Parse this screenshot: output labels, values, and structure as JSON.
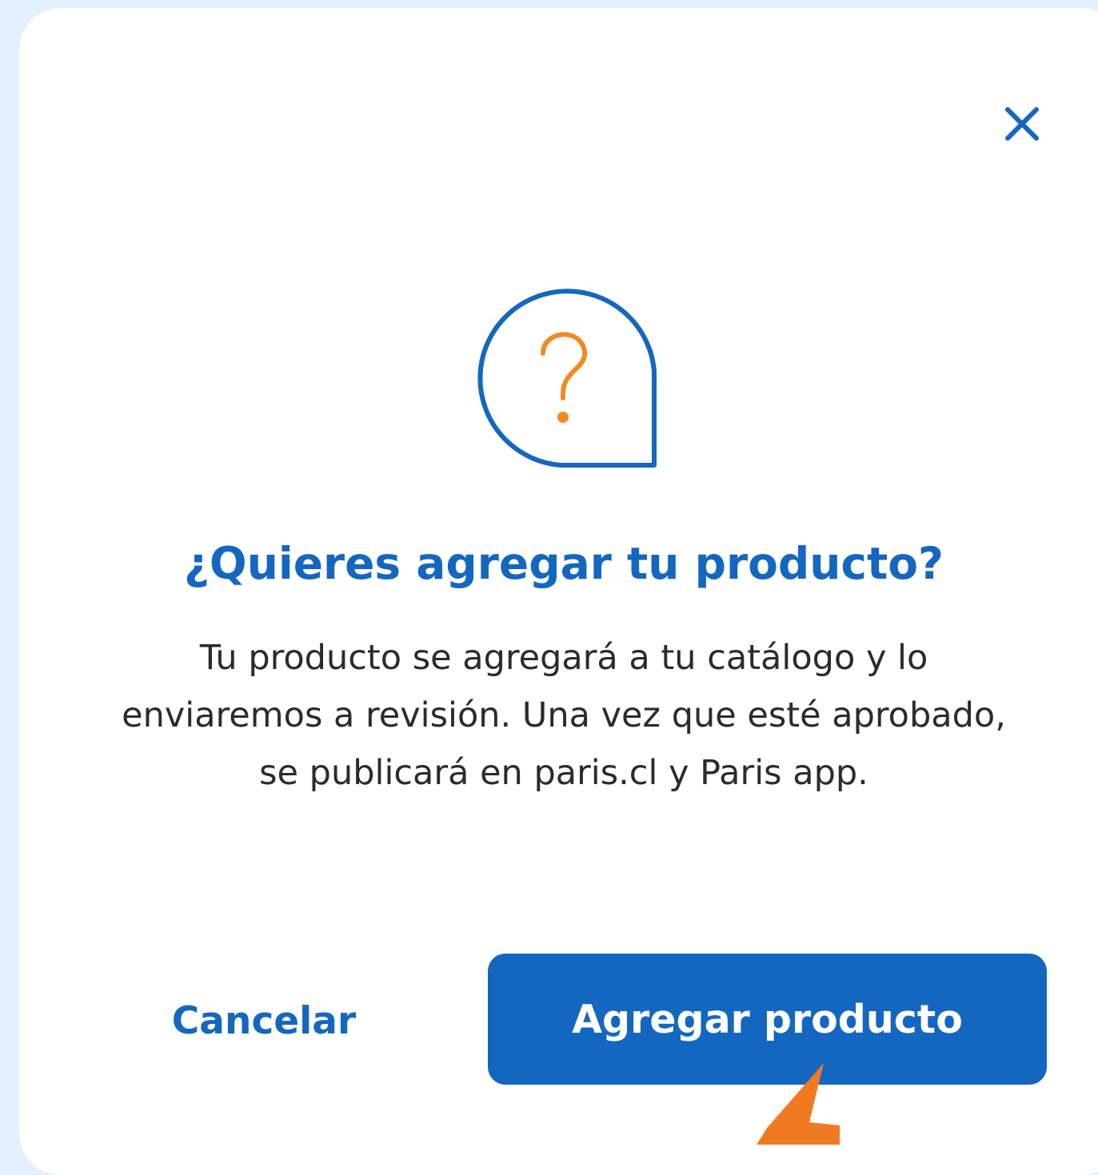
{
  "dialog": {
    "title": "¿Quieres agregar tu producto?",
    "description_lines": [
      "Tu producto se agregará a tu catálogo y lo",
      "enviaremos a revisión. Una vez que esté aprobado,",
      "se publicará en paris.cl y Paris app."
    ],
    "close_icon": "close-icon",
    "illustration_icon": "question-bubble-icon",
    "cancel_label": "Cancelar",
    "confirm_label": "Agregar producto"
  },
  "annotation": {
    "icon": "pointer-arrow-icon",
    "color": "#f07a21"
  },
  "colors": {
    "background": "#e3f0fd",
    "accent": "#1467c0",
    "question_mark": "#f28a1f",
    "text": "#2b2b2b"
  }
}
